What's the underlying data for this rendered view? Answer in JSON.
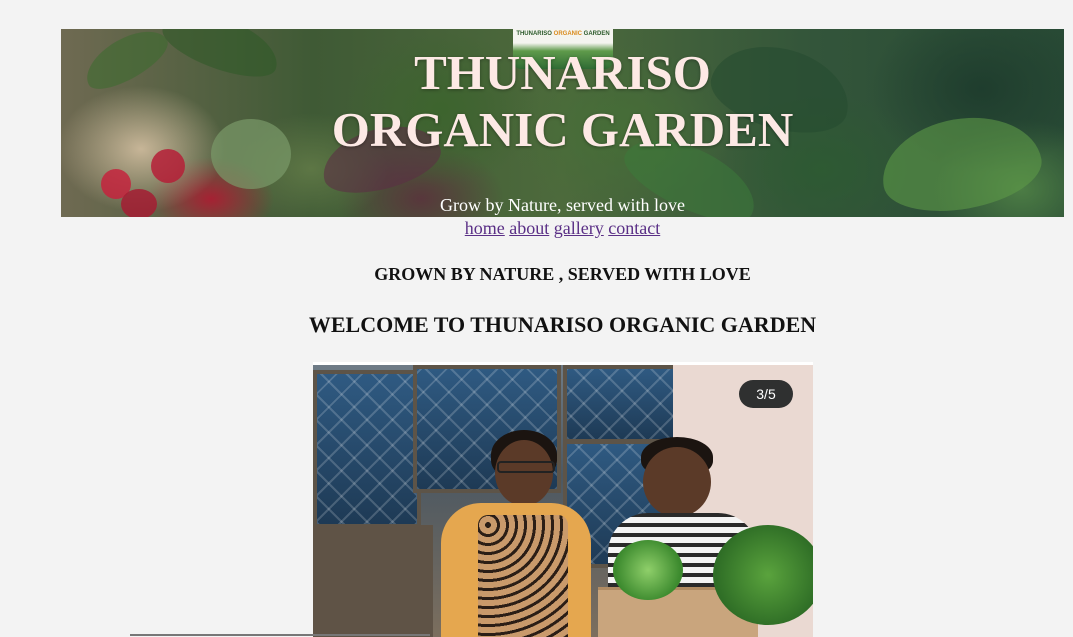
{
  "header": {
    "logo_text_left": "THUNARISO",
    "logo_text_accent": "ORGANIC",
    "logo_text_right": "GARDEN",
    "title_line1": "THUNARISO",
    "title_line2": "ORGANIC GARDEN",
    "tagline": "Grow by Nature, served with love"
  },
  "nav": {
    "items": [
      {
        "label": "home"
      },
      {
        "label": "about"
      },
      {
        "label": "gallery"
      },
      {
        "label": "contact"
      }
    ]
  },
  "main": {
    "subheading": "GROWN BY NATURE , SERVED WITH LOVE",
    "heading": "WELCOME TO THUNARISO ORGANIC GARDEN",
    "slideshow": {
      "counter": "3/5"
    }
  },
  "colors": {
    "background": "#f3f3f3",
    "title": "#fde9e5",
    "link": "#5a2f86"
  }
}
